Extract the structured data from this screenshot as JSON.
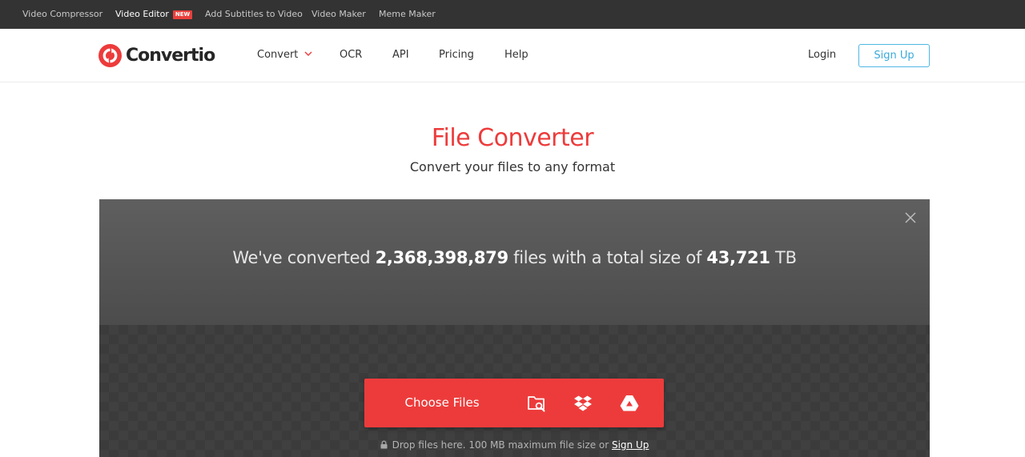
{
  "topbar": {
    "links": [
      {
        "label": "Video Compressor"
      },
      {
        "label": "Video Editor",
        "badge": "NEW"
      },
      {
        "label": "Add Subtitles to Video"
      },
      {
        "label": "Video Maker"
      },
      {
        "label": "Meme Maker"
      }
    ]
  },
  "header": {
    "logo_text": "Convertio",
    "nav": [
      {
        "label": "Convert"
      },
      {
        "label": "OCR"
      },
      {
        "label": "API"
      },
      {
        "label": "Pricing"
      },
      {
        "label": "Help"
      }
    ],
    "login_label": "Login",
    "signup_label": "Sign Up"
  },
  "hero": {
    "title": "File Converter",
    "subtitle": "Convert your files to any format"
  },
  "stats": {
    "prefix": "We've converted ",
    "files_count": "2,368,398,879",
    "middle": " files with a total size of ",
    "total_size": "43,721",
    "unit": " TB"
  },
  "upload": {
    "choose_label": "Choose Files",
    "sources": [
      "folder-search-icon",
      "dropbox-icon",
      "google-drive-icon"
    ],
    "note_prefix": "Drop files here. 100 MB maximum file size or ",
    "note_link": "Sign Up"
  },
  "colors": {
    "brand_red": "#ed3b3b",
    "topbar_bg": "#333333",
    "signup_blue": "#3aa9da",
    "stats_bg": "#555555",
    "dropzone_bg": "#3b3b3b"
  }
}
